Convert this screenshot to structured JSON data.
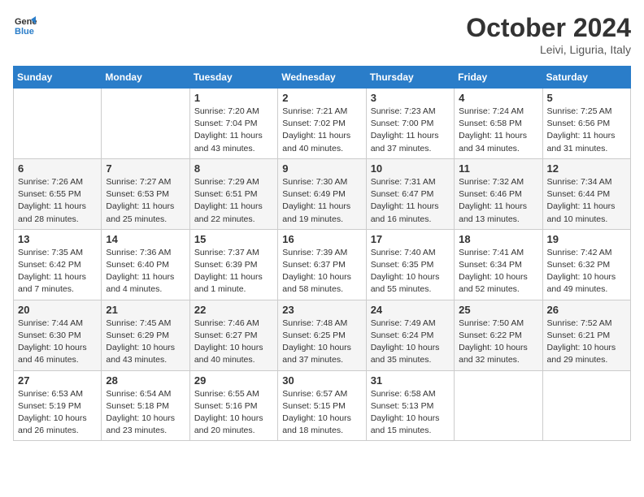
{
  "header": {
    "logo_line1": "General",
    "logo_line2": "Blue",
    "month": "October 2024",
    "location": "Leivi, Liguria, Italy"
  },
  "weekdays": [
    "Sunday",
    "Monday",
    "Tuesday",
    "Wednesday",
    "Thursday",
    "Friday",
    "Saturday"
  ],
  "weeks": [
    [
      {
        "day": "",
        "info": ""
      },
      {
        "day": "",
        "info": ""
      },
      {
        "day": "1",
        "info": "Sunrise: 7:20 AM\nSunset: 7:04 PM\nDaylight: 11 hours and 43 minutes."
      },
      {
        "day": "2",
        "info": "Sunrise: 7:21 AM\nSunset: 7:02 PM\nDaylight: 11 hours and 40 minutes."
      },
      {
        "day": "3",
        "info": "Sunrise: 7:23 AM\nSunset: 7:00 PM\nDaylight: 11 hours and 37 minutes."
      },
      {
        "day": "4",
        "info": "Sunrise: 7:24 AM\nSunset: 6:58 PM\nDaylight: 11 hours and 34 minutes."
      },
      {
        "day": "5",
        "info": "Sunrise: 7:25 AM\nSunset: 6:56 PM\nDaylight: 11 hours and 31 minutes."
      }
    ],
    [
      {
        "day": "6",
        "info": "Sunrise: 7:26 AM\nSunset: 6:55 PM\nDaylight: 11 hours and 28 minutes."
      },
      {
        "day": "7",
        "info": "Sunrise: 7:27 AM\nSunset: 6:53 PM\nDaylight: 11 hours and 25 minutes."
      },
      {
        "day": "8",
        "info": "Sunrise: 7:29 AM\nSunset: 6:51 PM\nDaylight: 11 hours and 22 minutes."
      },
      {
        "day": "9",
        "info": "Sunrise: 7:30 AM\nSunset: 6:49 PM\nDaylight: 11 hours and 19 minutes."
      },
      {
        "day": "10",
        "info": "Sunrise: 7:31 AM\nSunset: 6:47 PM\nDaylight: 11 hours and 16 minutes."
      },
      {
        "day": "11",
        "info": "Sunrise: 7:32 AM\nSunset: 6:46 PM\nDaylight: 11 hours and 13 minutes."
      },
      {
        "day": "12",
        "info": "Sunrise: 7:34 AM\nSunset: 6:44 PM\nDaylight: 11 hours and 10 minutes."
      }
    ],
    [
      {
        "day": "13",
        "info": "Sunrise: 7:35 AM\nSunset: 6:42 PM\nDaylight: 11 hours and 7 minutes."
      },
      {
        "day": "14",
        "info": "Sunrise: 7:36 AM\nSunset: 6:40 PM\nDaylight: 11 hours and 4 minutes."
      },
      {
        "day": "15",
        "info": "Sunrise: 7:37 AM\nSunset: 6:39 PM\nDaylight: 11 hours and 1 minute."
      },
      {
        "day": "16",
        "info": "Sunrise: 7:39 AM\nSunset: 6:37 PM\nDaylight: 10 hours and 58 minutes."
      },
      {
        "day": "17",
        "info": "Sunrise: 7:40 AM\nSunset: 6:35 PM\nDaylight: 10 hours and 55 minutes."
      },
      {
        "day": "18",
        "info": "Sunrise: 7:41 AM\nSunset: 6:34 PM\nDaylight: 10 hours and 52 minutes."
      },
      {
        "day": "19",
        "info": "Sunrise: 7:42 AM\nSunset: 6:32 PM\nDaylight: 10 hours and 49 minutes."
      }
    ],
    [
      {
        "day": "20",
        "info": "Sunrise: 7:44 AM\nSunset: 6:30 PM\nDaylight: 10 hours and 46 minutes."
      },
      {
        "day": "21",
        "info": "Sunrise: 7:45 AM\nSunset: 6:29 PM\nDaylight: 10 hours and 43 minutes."
      },
      {
        "day": "22",
        "info": "Sunrise: 7:46 AM\nSunset: 6:27 PM\nDaylight: 10 hours and 40 minutes."
      },
      {
        "day": "23",
        "info": "Sunrise: 7:48 AM\nSunset: 6:25 PM\nDaylight: 10 hours and 37 minutes."
      },
      {
        "day": "24",
        "info": "Sunrise: 7:49 AM\nSunset: 6:24 PM\nDaylight: 10 hours and 35 minutes."
      },
      {
        "day": "25",
        "info": "Sunrise: 7:50 AM\nSunset: 6:22 PM\nDaylight: 10 hours and 32 minutes."
      },
      {
        "day": "26",
        "info": "Sunrise: 7:52 AM\nSunset: 6:21 PM\nDaylight: 10 hours and 29 minutes."
      }
    ],
    [
      {
        "day": "27",
        "info": "Sunrise: 6:53 AM\nSunset: 5:19 PM\nDaylight: 10 hours and 26 minutes."
      },
      {
        "day": "28",
        "info": "Sunrise: 6:54 AM\nSunset: 5:18 PM\nDaylight: 10 hours and 23 minutes."
      },
      {
        "day": "29",
        "info": "Sunrise: 6:55 AM\nSunset: 5:16 PM\nDaylight: 10 hours and 20 minutes."
      },
      {
        "day": "30",
        "info": "Sunrise: 6:57 AM\nSunset: 5:15 PM\nDaylight: 10 hours and 18 minutes."
      },
      {
        "day": "31",
        "info": "Sunrise: 6:58 AM\nSunset: 5:13 PM\nDaylight: 10 hours and 15 minutes."
      },
      {
        "day": "",
        "info": ""
      },
      {
        "day": "",
        "info": ""
      }
    ]
  ]
}
